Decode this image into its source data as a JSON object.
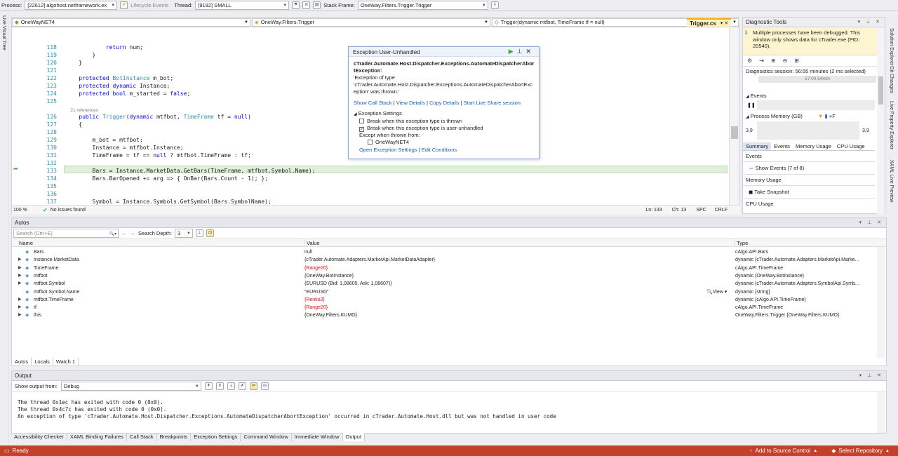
{
  "toolbar": {
    "process_label": "Process:",
    "process_value": "[22612] algohost.netframework.ex",
    "lifecycle": "Lifecycle Events",
    "thread_label": "Thread:",
    "thread_value": "[9192] SMALL",
    "stack_label": "Stack Frame:",
    "stack_value": "OneWay.Filters.Trigger.Trigger"
  },
  "left_strip": "Live Visual Tree",
  "right_strip": [
    "Solution Explorer",
    "Git Changes",
    "Live Property Explorer",
    "XAML Live Preview"
  ],
  "editor": {
    "file_tab": "Trigger.cs",
    "nav_project": "OneWayNET4",
    "nav_class": "OneWay.Filters.Trigger",
    "nav_member": "Trigger(dynamic mtfbot, TimeFrame tf = null)",
    "lines": [
      {
        "n": "118",
        "t": "            return num;"
      },
      {
        "n": "119",
        "t": "        }"
      },
      {
        "n": "120",
        "t": "    }"
      },
      {
        "n": "121",
        "t": ""
      },
      {
        "n": "122",
        "t": "    protected BotInstance m_bot;"
      },
      {
        "n": "123",
        "t": "    protected dynamic Instance;"
      },
      {
        "n": "124",
        "t": "    protected bool m_started = false;"
      },
      {
        "n": "125",
        "t": ""
      },
      {
        "n": "",
        "t": "    21 references"
      },
      {
        "n": "126",
        "t": "    public Trigger(dynamic mtfbot, TimeFrame tf = null)"
      },
      {
        "n": "127",
        "t": "    {"
      },
      {
        "n": "128",
        "t": ""
      },
      {
        "n": "129",
        "t": "        m_bot = mtfbot;"
      },
      {
        "n": "130",
        "t": "        Instance = mtfbot.Instance;"
      },
      {
        "n": "131",
        "t": "        TimeFrame = tf == null ? mtfbot.TimeFrame : tf;"
      },
      {
        "n": "132",
        "t": ""
      },
      {
        "n": "133",
        "t": "        Bars = Instance.MarketData.GetBars(TimeFrame, mtfbot.Symbol.Name);"
      },
      {
        "n": "134",
        "t": "        Bars.BarOpened += arg => { OnBar(Bars.Count - 1); };"
      },
      {
        "n": "135",
        "t": ""
      },
      {
        "n": "136",
        "t": ""
      },
      {
        "n": "137",
        "t": "        Symbol = Instance.Symbols.GetSymbol(Bars.SymbolName);"
      }
    ],
    "zoom": "100 %",
    "issues": "No issues found",
    "ln": "Ln: 133",
    "ch": "Ch: 13",
    "spc": "SPC",
    "crlf": "CRLF"
  },
  "exception": {
    "title": "Exception User-Unhandled",
    "type": "cTrader.Automate.Host.Dispatcher.Exceptions.AutomateDispatcherAbortException:",
    "msg": "'Exception of type 'cTrader.Automate.Host.Dispatcher.Exceptions.AutomateDispatcherAbortException' was thrown.'",
    "links": [
      "Show Call Stack",
      "View Details",
      "Copy Details",
      "Start Live Share session"
    ],
    "settings": "Exception Settings",
    "opt1": "Break when this exception type is thrown",
    "opt2": "Break when this exception type is user-unhandled",
    "except": "Except when thrown from:",
    "module": "OneWayNET4",
    "link_open": "Open Exception Settings",
    "link_edit": "Edit Conditions"
  },
  "diag": {
    "title": "Diagnostic Tools",
    "info": "Multiple processes have been debugged. This window only shows data for cTrader.exe (PID: 20540).",
    "session": "Diagnostics session: 56:55 minutes (2 ms selected)",
    "tick": "57:00,54min",
    "events": "Events",
    "memory": "Process Memory (GB)",
    "f_label": "F",
    "mem_left": "3,9",
    "mem_right": "3,9",
    "tabs": [
      "Summary",
      "Events",
      "Memory Usage",
      "CPU Usage"
    ],
    "sec_events": "Events",
    "show_events": "Show Events (7 of 8)",
    "sec_mem": "Memory Usage",
    "snapshot": "Take Snapshot",
    "sec_cpu": "CPU Usage"
  },
  "autos": {
    "title": "Autos",
    "search_placeholder": "Search (Ctrl+E)",
    "depth_label": "Search Depth:",
    "depth": "3",
    "cols": [
      "Name",
      "Value",
      "Type"
    ],
    "rows": [
      {
        "name": "Bars",
        "value": "null",
        "type": "cAlgo.API.Bars",
        "red": false,
        "exp": false
      },
      {
        "name": "Instance.MarketData",
        "value": "{cTrader.Automate.Adapters.MarketApi.MarketDataAdapter}",
        "type": "dynamic {cTrader.Automate.Adapters.MarketApi.Marke...",
        "red": false,
        "exp": true
      },
      {
        "name": "TimeFrame",
        "value": "{Range20}",
        "type": "cAlgo.API.TimeFrame",
        "red": true,
        "exp": true
      },
      {
        "name": "mtfbot",
        "value": "{OneWay.BotInstance}",
        "type": "dynamic {OneWay.BotInstance}",
        "red": false,
        "exp": true
      },
      {
        "name": "mtfbot.Symbol",
        "value": "{EURUSD (Bid: 1,08605, Ask: 1,08607)}",
        "type": "dynamic {cTrader.Automate.Adapters.SymbolApi.Symb...",
        "red": false,
        "exp": true
      },
      {
        "name": "mtfbot.Symbol.Name",
        "value": "\"EURUSD\"",
        "type": "dynamic {string}",
        "red": false,
        "exp": false,
        "view": "View"
      },
      {
        "name": "mtfbot.TimeFrame",
        "value": "{Renko2}",
        "type": "dynamic {cAlgo.API.TimeFrame}",
        "red": true,
        "exp": true
      },
      {
        "name": "tf",
        "value": "{Range20}",
        "type": "cAlgo.API.TimeFrame",
        "red": true,
        "exp": true
      },
      {
        "name": "this",
        "value": "{OneWay.Filters.KUMO}",
        "type": "OneWay.Filters.Trigger {OneWay.Filters.KUMO}",
        "red": false,
        "exp": true
      }
    ],
    "tabs": [
      "Autos",
      "Locals",
      "Watch 1"
    ]
  },
  "output": {
    "title": "Output",
    "from_label": "Show output from:",
    "from": "Debug",
    "lines": [
      "The thread 0x1ec has exited with code 0 (0x0).",
      "The thread 0x4c7c has exited with code 0 (0x0).",
      "An exception of type 'cTrader.Automate.Host.Dispatcher.Exceptions.AutomateDispatcherAbortException' occurred in cTrader.Automate.Host.dll but was not handled in user code"
    ],
    "tabs": [
      "Accessibility Checker",
      "XAML Binding Failures",
      "Call Stack",
      "Breakpoints",
      "Exception Settings",
      "Command Window",
      "Immediate Window",
      "Output"
    ]
  },
  "status": {
    "ready": "Ready",
    "source": "Add to Source Control",
    "repo": "Select Repository"
  }
}
